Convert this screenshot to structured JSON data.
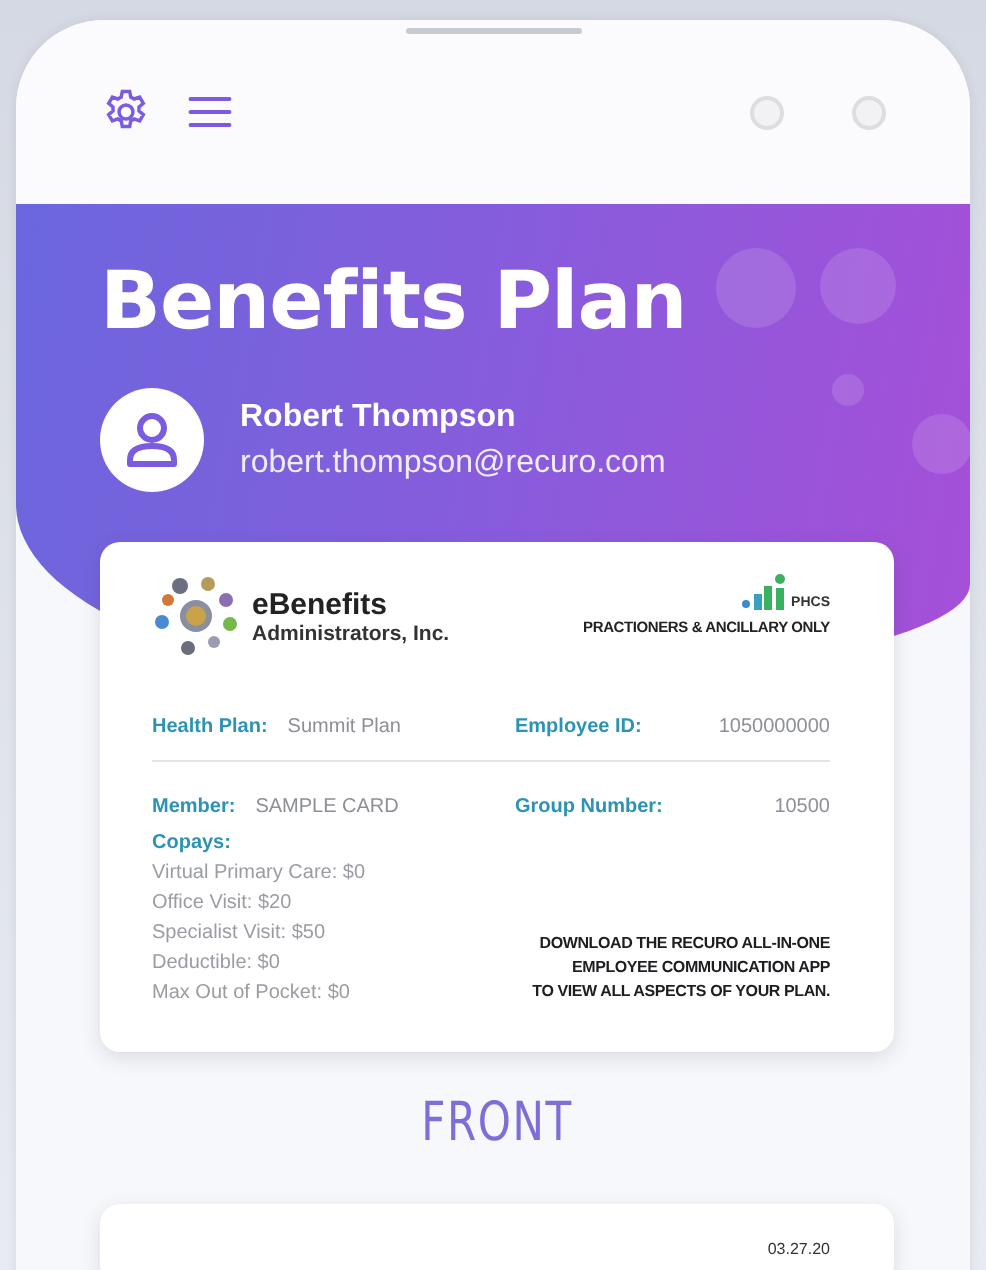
{
  "header": {
    "title": "Benefits Plan",
    "user": {
      "name": "Robert Thompson",
      "email": "robert.thompson@recuro.com"
    }
  },
  "card": {
    "company": {
      "line_1": "eBenefits",
      "line_2": "Administrators, Inc."
    },
    "network": {
      "name": "PHCS",
      "note": "PRACTIONERS & ANCILLARY ONLY"
    },
    "fields": [
      {
        "label": "Health Plan:",
        "value": "Summit Plan"
      },
      {
        "label": "Employee ID:",
        "value": "1050000000"
      },
      {
        "label": "Member:",
        "value": "SAMPLE CARD"
      },
      {
        "label": "Group Number:",
        "value": "10500"
      }
    ],
    "copays": {
      "title": "Copays:",
      "items": [
        "Virtual Primary Care: $0",
        "Office Visit: $20",
        "Specialist Visit: $50",
        "Deductible: $0",
        "Max Out of Pocket: $0"
      ]
    },
    "promo": [
      "DOWNLOAD THE RECURO ALL-IN-ONE",
      "EMPLOYEE COMMUNICATION APP",
      "TO VIEW ALL ASPECTS OF YOUR PLAN."
    ]
  },
  "side_label": "FRONT",
  "next_card": {
    "date": "03.27.20"
  }
}
